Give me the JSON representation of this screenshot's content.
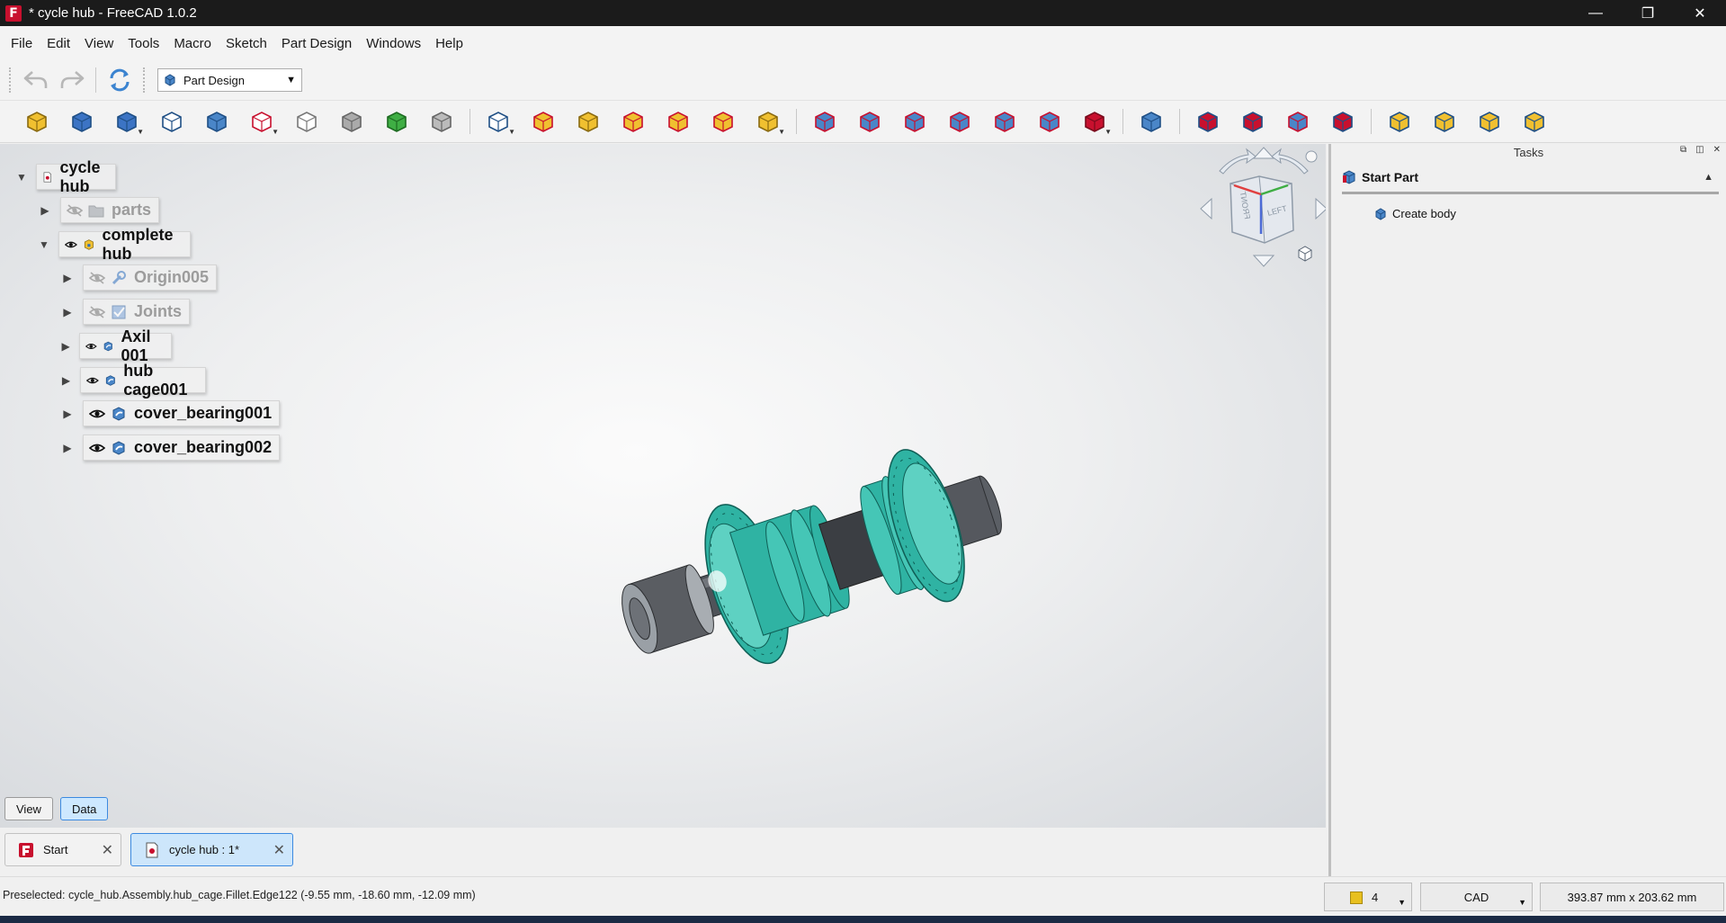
{
  "window": {
    "title": "* cycle hub - FreeCAD 1.0.2",
    "logo_letter": "F",
    "controls": {
      "minimize": "—",
      "restore": "❐",
      "close": "✕"
    }
  },
  "menubar": [
    "File",
    "Edit",
    "View",
    "Tools",
    "Macro",
    "Sketch",
    "Part Design",
    "Windows",
    "Help"
  ],
  "toolbar1": {
    "workbench": "Part Design",
    "buttons": [
      "undo-icon",
      "redo-icon",
      "refresh-icon"
    ]
  },
  "toolbar2": {
    "icons": [
      "part-icon",
      "group-icon",
      "link-icon",
      "variable-set-icon",
      "body-icon",
      "sketch-icon",
      "validate-sketch-icon",
      "shape-binder-icon",
      "subshape-binder-icon",
      "clone-icon",
      "datum-plane-icon",
      "pad-icon",
      "revolution-icon",
      "additive-loft-icon",
      "additive-pipe-icon",
      "additive-helix-icon",
      "additive-primitive-icon",
      "pocket-icon",
      "hole-icon",
      "groove-icon",
      "subtractive-loft-icon",
      "subtractive-pipe-icon",
      "subtractive-helix-icon",
      "subtractive-primitive-icon",
      "boolean-icon",
      "fillet-icon",
      "chamfer-icon",
      "draft-icon",
      "thickness-icon",
      "mirrored-icon",
      "linear-pattern-icon",
      "polar-pattern-icon",
      "multi-transform-icon"
    ]
  },
  "tree": {
    "items": [
      {
        "label": "cycle hub",
        "expanded": true,
        "visible": null,
        "icon": "document-icon",
        "dim": false
      },
      {
        "label": "parts",
        "expanded": false,
        "visible": false,
        "icon": "folder-icon",
        "dim": true
      },
      {
        "label": "complete hub",
        "expanded": true,
        "visible": true,
        "icon": "assembly-icon",
        "dim": false
      },
      {
        "label": "Origin005",
        "expanded": false,
        "visible": false,
        "icon": "origin-icon",
        "dim": true
      },
      {
        "label": "Joints",
        "expanded": false,
        "visible": false,
        "icon": "joints-icon",
        "dim": true
      },
      {
        "label": "Axil 001",
        "expanded": false,
        "visible": true,
        "icon": "link-part-icon",
        "dim": false
      },
      {
        "label": "hub cage001",
        "expanded": false,
        "visible": true,
        "icon": "link-part-icon",
        "dim": false
      },
      {
        "label": "cover_bearing001",
        "expanded": false,
        "visible": true,
        "icon": "link-part-icon",
        "dim": false
      },
      {
        "label": "cover_bearing002",
        "expanded": false,
        "visible": true,
        "icon": "link-part-icon",
        "dim": false
      }
    ]
  },
  "navcube": {
    "faces": [
      "FRONT",
      "LEFT"
    ]
  },
  "view_tabs": {
    "view": "View",
    "data": "Data",
    "active": "Data"
  },
  "tasks": {
    "header": "Tasks",
    "box_title": "Start Part",
    "actions": [
      "Create body"
    ]
  },
  "mdi_tabs": [
    {
      "label": "Start",
      "active": false
    },
    {
      "label": "cycle hub : 1*",
      "active": true
    }
  ],
  "statusbar": {
    "message": "Preselected: cycle_hub.Assembly.hub_cage.Fillet.Edge122 (-9.55 mm, -18.60 mm, -12.09 mm)",
    "notifications_count": "4",
    "navigation_style": "CAD",
    "dimensions": "393.87 mm x 203.62 mm"
  },
  "colors": {
    "hub_teal": "#2fb3a3",
    "axle_gray": "#55585e",
    "accent_blue": "#3c8ae0",
    "titlebar": "#1b1b1b"
  }
}
